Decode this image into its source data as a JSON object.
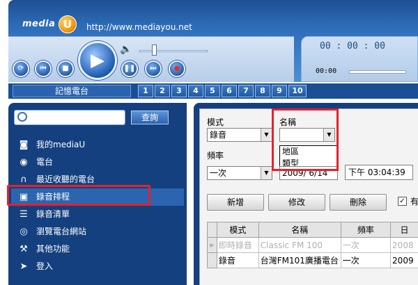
{
  "header": {
    "logo_text": "media",
    "logo_letter": "U",
    "url": "http://www.mediayou.net"
  },
  "player": {
    "time_top": "00 : 00 : 00",
    "time_bottom": "00:00"
  },
  "station_bar": {
    "label": "記憶電台",
    "numbers": [
      "1",
      "2",
      "3",
      "4",
      "5",
      "6",
      "7",
      "8",
      "9",
      "10"
    ]
  },
  "sidebar": {
    "search_placeholder": "",
    "search_button": "查詢",
    "items": [
      {
        "label": "我的mediaU",
        "icon": "headphone-icon"
      },
      {
        "label": "電台",
        "icon": "broadcast-icon"
      },
      {
        "label": "最近收聽的電台",
        "icon": "headset-icon"
      },
      {
        "label": "錄音排程",
        "icon": "tape-icon"
      },
      {
        "label": "錄音清單",
        "icon": "list-icon"
      },
      {
        "label": "瀏覽電台網站",
        "icon": "globe-icon"
      },
      {
        "label": "其他功能",
        "icon": "tools-icon"
      },
      {
        "label": "登入",
        "icon": "login-icon"
      }
    ]
  },
  "form": {
    "mode_label": "模式",
    "mode_value": "錄音",
    "name_label": "名稱",
    "name_value": "",
    "name_options": [
      "地區",
      "類型"
    ],
    "freq_label": "頻率",
    "freq_value": "一次",
    "date_value": "2009/ 6/14",
    "time_value": "下午 03:04:39",
    "add_button": "新增",
    "edit_button": "修改",
    "delete_button": "刪除",
    "checkbox_label": "有",
    "checkbox_mark": "✓"
  },
  "table": {
    "headers": [
      "模式",
      "名稱",
      "頻率",
      "日"
    ],
    "rows": [
      {
        "marker": "▶",
        "mode": "即時錄音",
        "name": "Classic FM 100",
        "freq": "一次",
        "date": "2008"
      },
      {
        "marker": "",
        "mode": "錄音",
        "name": "台灣FM101廣播電台",
        "freq": "一次",
        "date": "2009"
      }
    ]
  }
}
